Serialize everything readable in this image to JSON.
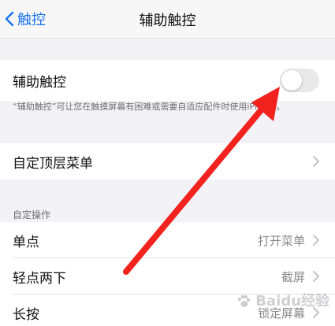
{
  "nav": {
    "back_label": "触控",
    "title": "辅助触控"
  },
  "assistive_touch": {
    "label": "辅助触控",
    "enabled": false,
    "footnote": "“辅助触控”可让您在触摸屏幕有困难或需要自适应配件时使用iPhone。"
  },
  "customize_menu": {
    "label": "自定顶层菜单"
  },
  "custom_actions": {
    "header": "自定操作",
    "items": [
      {
        "label": "单点",
        "value": "打开菜单"
      },
      {
        "label": "轻点两下",
        "value": "截屏"
      },
      {
        "label": "长按",
        "value": "锁定屏幕"
      }
    ]
  },
  "overlay": {
    "arrow_color": "#f2231f",
    "watermark_text": "Baidu经验"
  },
  "colors": {
    "accent": "#1a73e8",
    "toggle_off": "#e9e9ea",
    "background": "#f2f2f7"
  }
}
